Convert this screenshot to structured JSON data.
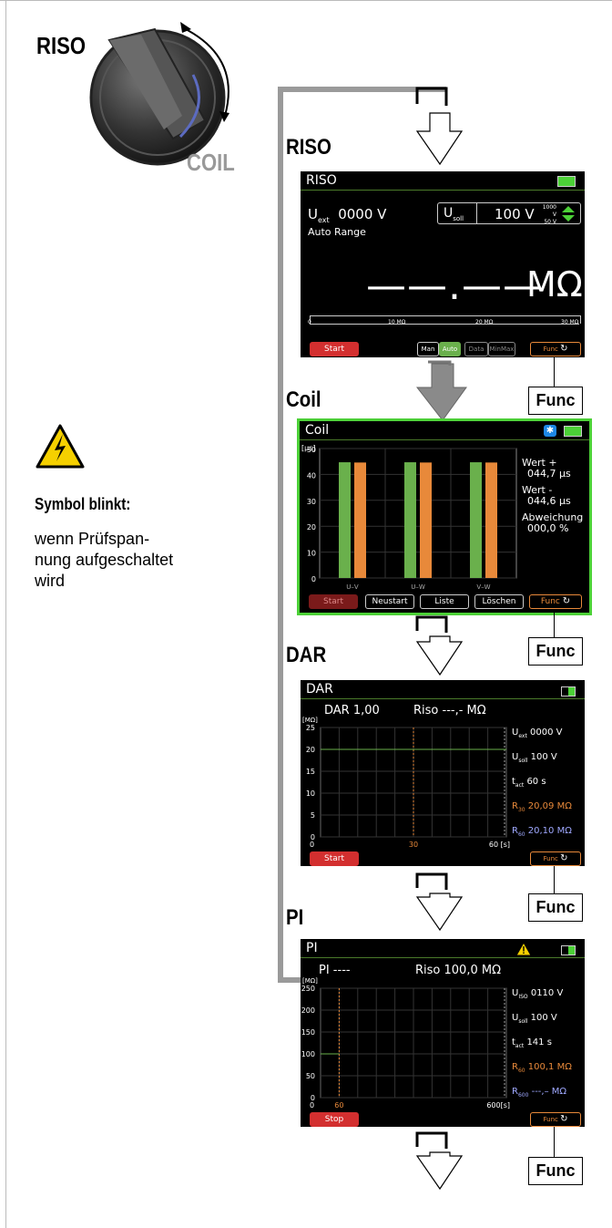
{
  "dial": {
    "riso_label": "RISO",
    "coil_label": "COIL"
  },
  "sidebar": {
    "symbol_heading": "Symbol blinkt:",
    "symbol_text_lines": [
      "wenn Prüfspan-",
      "nung aufgeschaltet",
      "wird"
    ]
  },
  "steps": {
    "riso": "RISO",
    "coil": "Coil",
    "dar": "DAR",
    "pi": "PI"
  },
  "func_label": "Func",
  "riso_screen": {
    "title": "RISO",
    "uext_label": "U",
    "uext_sub": "ext",
    "uext_value": "0000 V",
    "auto_range": "Auto Range",
    "usoll_label": "U",
    "usoll_sub": "soll",
    "usoll_value": "100 V",
    "range_hi": "1000 V",
    "range_lo": "50 V",
    "reading": "——.——",
    "unit": "MΩ",
    "scale": [
      "0",
      "10 MΩ",
      "20 MΩ",
      "30 MΩ"
    ],
    "buttons": {
      "start": "Start",
      "man": "Man",
      "auto": "Auto",
      "data": "Data",
      "minmax": "MinMax",
      "func": "Func"
    }
  },
  "coil_screen": {
    "title": "Coil",
    "y_unit": "[μs]",
    "y_ticks": [
      "50",
      "40",
      "30",
      "20",
      "10",
      "0"
    ],
    "x_labels": [
      "U–V",
      "U–W",
      "V–W"
    ],
    "wert_plus_label": "Wert  +",
    "wert_plus_value": "044,7 μs",
    "wert_minus_label": "Wert  -",
    "wert_minus_value": "044,6 μs",
    "abw_label": "Abweichung",
    "abw_value": "000,0 %",
    "buttons": {
      "start": "Start",
      "neustart": "Neustart",
      "liste": "Liste",
      "loeschen": "Löschen",
      "func": "Func"
    },
    "colors": {
      "green": "#6ab04c",
      "orange": "#e8893a",
      "frame": "#4cd137"
    }
  },
  "chart_data": [
    {
      "type": "bar",
      "categories": [
        "U–V",
        "U–W",
        "V–W"
      ],
      "series": [
        {
          "values": [
            44.7,
            44.7,
            44.7
          ]
        },
        {
          "values": [
            44.6,
            44.6,
            44.6
          ]
        }
      ],
      "ylabel": "[μs]",
      "ylim": [
        0,
        50
      ]
    },
    {
      "type": "line",
      "title": "DAR 1,00",
      "ylabel": "[MΩ]",
      "ylim": [
        0,
        25
      ],
      "xlim": [
        0,
        60
      ],
      "y_ticks": [
        "25",
        "20",
        "15",
        "10",
        "5",
        "0"
      ],
      "x_ticks": [
        "0",
        "30",
        "60 [s]"
      ],
      "series": [
        {
          "x": [
            0,
            60
          ],
          "y": [
            20,
            20
          ]
        }
      ]
    },
    {
      "type": "line",
      "title": "PI ----",
      "ylabel": "[MΩ]",
      "ylim": [
        0,
        250
      ],
      "xlim": [
        0,
        600
      ],
      "y_ticks": [
        "250",
        "200",
        "150",
        "100",
        "50",
        "0"
      ],
      "x_ticks": [
        "0",
        "60",
        "600[s]"
      ],
      "series": [
        {
          "x": [
            0,
            60
          ],
          "y": [
            100,
            100
          ]
        }
      ]
    }
  ],
  "dar_screen": {
    "title": "DAR",
    "dar_value": "DAR 1,00",
    "riso_value": "Riso  ---,- MΩ",
    "y_unit": "[MΩ]",
    "y_ticks": [
      "25",
      "20",
      "15",
      "10",
      "5",
      "0"
    ],
    "x_ticks": [
      "30",
      "60 [s]"
    ],
    "uext": "0000 V",
    "usoll": "100 V",
    "tact": "60 s",
    "r30": "20,09 MΩ",
    "r60": "20,10 MΩ",
    "sub_ext": "ext",
    "sub_soll": "soll",
    "sub_act": "act",
    "sub_30": "30",
    "sub_60": "60",
    "start": "Start",
    "func": "Func"
  },
  "pi_screen": {
    "title": "PI",
    "pi_value": "PI ----",
    "riso_value": "Riso  100,0 MΩ",
    "y_unit": "[MΩ]",
    "y_ticks": [
      "250",
      "200",
      "150",
      "100",
      "50",
      "0"
    ],
    "x_ticks": [
      "60",
      "600[s]"
    ],
    "uiso": "0110 V",
    "usoll": "100 V",
    "tact": "141 s",
    "r60": "100,1 MΩ",
    "r600": "---,– MΩ",
    "sub_iso": "ISO",
    "sub_soll": "soll",
    "sub_act": "act",
    "sub_60": "60",
    "sub_600": "600",
    "stop": "Stop",
    "func": "Func"
  }
}
